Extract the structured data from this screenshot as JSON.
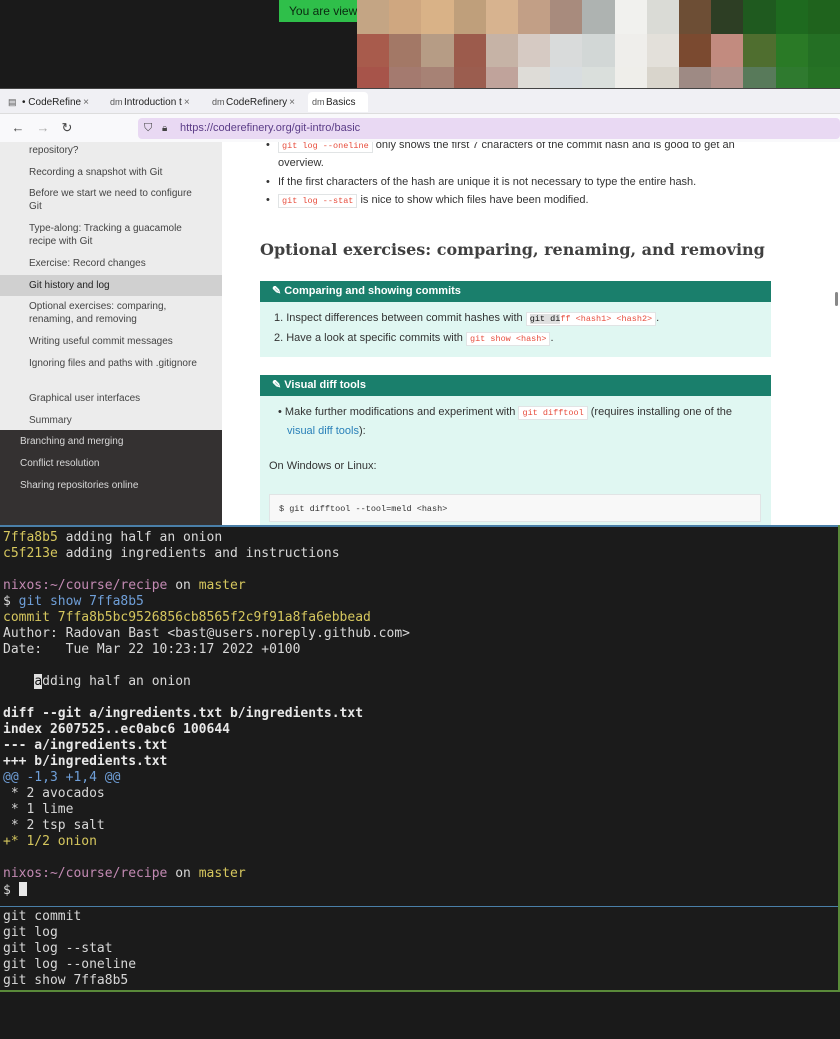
{
  "banner": {
    "text": "You are view"
  },
  "mosaic": {
    "colors": [
      "#c4a584",
      "#cfa780",
      "#d9b287",
      "#bf9f7b",
      "#d7b38f",
      "#c29f86",
      "#a88b7d",
      "#aeb3b1",
      "#f1f1ee",
      "#dadbd6",
      "#6d4e35",
      "#2d3e24",
      "#1f5a1f",
      "#1e6a1f",
      "#1f631d",
      "#a85b4c",
      "#a37866",
      "#b69c85",
      "#9c5b4c",
      "#c6b3a6",
      "#d6cac3",
      "#d9dbdb",
      "#d2d7d6",
      "#efeeeb",
      "#e3e0da",
      "#7b4a30",
      "#c28b7f",
      "#4f6e2f",
      "#2a7a26",
      "#246f24",
      "#a7544a",
      "#a47a6f",
      "#a78275",
      "#9b5d4f",
      "#c0a39b",
      "#dedcd7",
      "#d8dde0",
      "#dadfdc",
      "#efeeea",
      "#d9d5cc",
      "#9e8a84",
      "#b1918a",
      "#587a5a",
      "#2f7a2f",
      "#267225",
      "#a35d55",
      "#b98a7c",
      "#443229",
      "#6c4b3c",
      "#4a3a34",
      "#9a8e88",
      "#c0c2c1",
      "#8e8e86",
      "#b3a89a",
      "#c3cbd1",
      "#a9b1c6",
      "#8fa1be",
      "#5c7b85",
      "#1f6c21",
      "#1c6b20"
    ]
  },
  "browser": {
    "tabs": [
      {
        "icon": "page-icon",
        "label": "• CodeRefine"
      },
      {
        "icon": "dm-icon",
        "label": "Introduction t"
      },
      {
        "icon": "dm-icon",
        "label": "CodeRefinery"
      },
      {
        "icon": "dm-icon",
        "label": "Basics"
      }
    ],
    "url": "https://coderefinery.org/git-intro/basic",
    "sidebar": {
      "subitems": [
        "repository?",
        "Recording a snapshot with Git",
        "Before we start we need to configure Git",
        "Type-along: Tracking a guacamole recipe with Git",
        "Exercise: Record changes",
        "Git history and log",
        "Optional exercises: comparing, renaming, and removing",
        "Writing useful commit messages",
        "Ignoring files and paths with .gitignore",
        "Graphical user interfaces",
        "Summary"
      ],
      "topitems": [
        "Branching and merging",
        "Conflict resolution",
        "Sharing repositories online"
      ]
    },
    "content": {
      "bullet1_code": "git log --oneline",
      "bullet1_text": " only shows the first 7 characters of the commit hash and is good to get an",
      "bullet1_cont": "overview.",
      "bullet2_text": "If the first characters of the hash are unique it is not necessary to type the entire hash.",
      "bullet3_code": "git log --stat",
      "bullet3_text": " is nice to show which files have been modified.",
      "heading": "Optional exercises: comparing, renaming, and removing",
      "admon1_title": "Comparing and showing commits",
      "admon1_item1_text": "1. Inspect differences between commit hashes with ",
      "admon1_item1_code_sel": "git di",
      "admon1_item1_code": "ff <hash1> <hash2>",
      "admon1_item2_text": "2. Have a look at specific commits with ",
      "admon1_item2_code": "git show <hash>",
      "admon2_title": "Visual diff tools",
      "admon2_item_text": "Make further modifications and experiment with ",
      "admon2_item_code": "git difftool",
      "admon2_item_text2": " (requires installing one of the",
      "admon2_link": "visual diff tools",
      "admon2_link_tail": "):",
      "admon2_os": "On Windows or Linux:",
      "admon2_cmd": "$ git difftool --tool=meld <hash>"
    }
  },
  "terminal": {
    "log1_hash": "7ffa8b5",
    "log1_msg": " adding half an onion",
    "log2_hash": "c5f213e",
    "log2_msg": " adding ingredients and instructions",
    "prompt_host": "nixos",
    "prompt_path": ":~/course/recipe",
    "prompt_on": " on ",
    "prompt_branch": "master",
    "cmd_dollar": "$ ",
    "cmd": "git show 7ffa8b5",
    "commit_line": "commit 7ffa8b5bc9526856cb8565f2c9f91a8fa6ebbead",
    "author_line": "Author: Radovan Bast <bast@users.noreply.github.com>",
    "date_line": "Date:   Tue Mar 22 10:23:17 2022 +0100",
    "msg_sel": "a",
    "msg_rest": "dding half an onion",
    "diff1": "diff --git a/ingredients.txt b/ingredients.txt",
    "diff2": "index 2607525..ec0abc6 100644",
    "diff3": "--- a/ingredients.txt",
    "diff4": "+++ b/ingredients.txt",
    "hunk": "@@ -1,3 +1,4 @@",
    "ctx1": " * 2 avocados",
    "ctx2": " * 1 lime",
    "ctx3": " * 2 tsp salt",
    "add1": "+* 1/2 onion",
    "prompt2_dollar": "$ "
  },
  "history": [
    "git commit",
    "git log",
    "git log --stat",
    "git log --oneline",
    "git show 7ffa8b5"
  ]
}
